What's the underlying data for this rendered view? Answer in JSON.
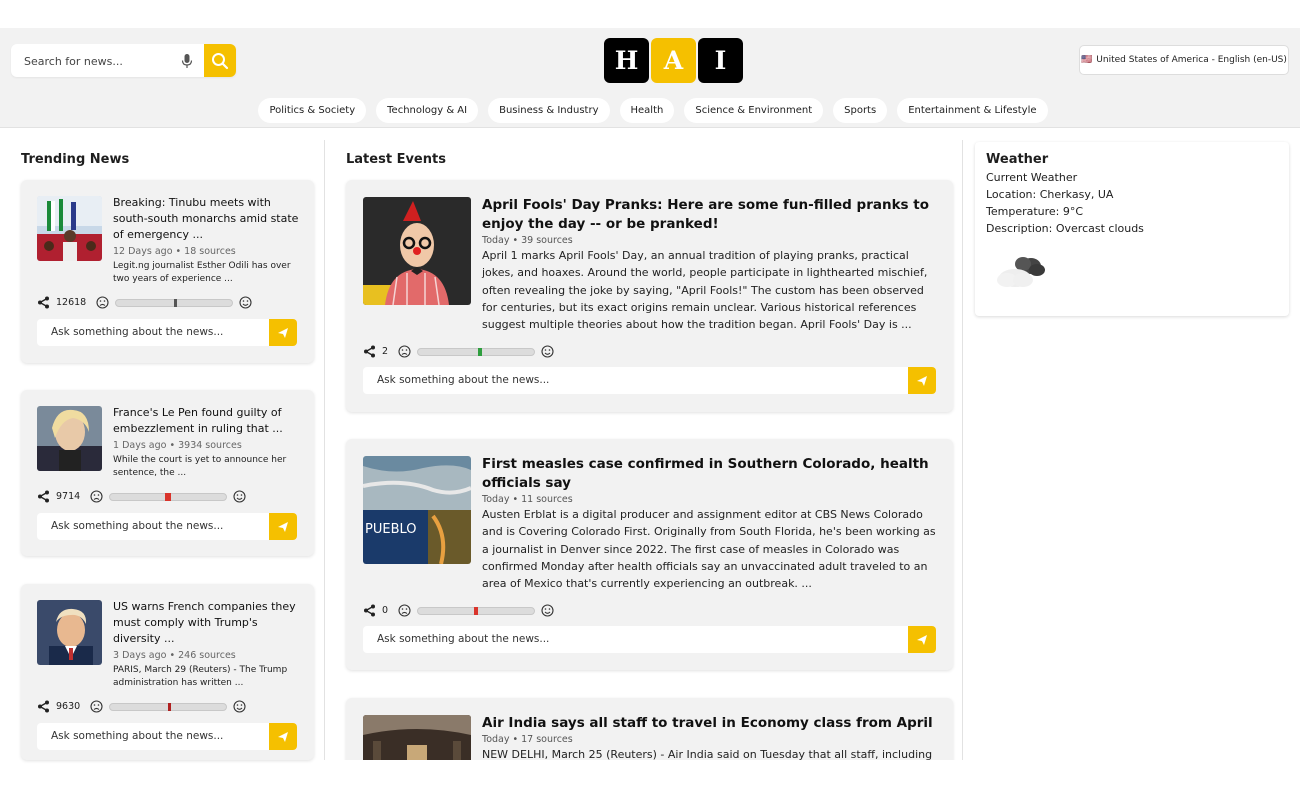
{
  "header": {
    "search_placeholder": "Search for news...",
    "logo_letters": [
      "H",
      "A",
      "I"
    ],
    "language_flag": "🇺🇸",
    "language_label": "United States of America - English (en-US)"
  },
  "categories": [
    "Politics & Society",
    "Technology & AI",
    "Business & Industry",
    "Health",
    "Science & Environment",
    "Sports",
    "Entertainment & Lifestyle"
  ],
  "trending": {
    "heading": "Trending News",
    "ask_placeholder": "Ask something about the news...",
    "items": [
      {
        "title": "Breaking: Tinubu meets with south-south monarchs amid state of emergency ...",
        "meta": "12 Days ago • 18 sources",
        "snippet": "Legit.ng journalist Esther Odili has over two years of experience ...",
        "shares": "12618",
        "sentiment": 0.5,
        "sentiment_color": "#555555"
      },
      {
        "title": "France's Le Pen found guilty of embezzlement in ruling that ...",
        "meta": "1 Days ago • 3934 sources",
        "snippet": "While the court is yet to announce her sentence, the ...",
        "shares": "9714",
        "sentiment": 0.47,
        "sentiment_color": "#d9342b"
      },
      {
        "title": "US warns French companies they must comply with Trump's diversity ...",
        "meta": "3 Days ago • 246 sources",
        "snippet": "PARIS, March 29 (Reuters) - The Trump administration has written ...",
        "shares": "9630",
        "sentiment": 0.5,
        "sentiment_color": "#b02020"
      }
    ]
  },
  "events": {
    "heading": "Latest Events",
    "ask_placeholder": "Ask something about the news...",
    "items": [
      {
        "title": "April Fools' Day Pranks: Here are some fun-filled pranks to enjoy the day -- or be pranked!",
        "meta": "Today • 39 sources",
        "body": "April 1 marks April Fools' Day, an annual tradition of playing pranks, practical jokes, and hoaxes. Around the world, people participate in lighthearted mischief, often revealing the joke by saying, \"April Fools!\" The custom has been observed for centuries, but its exact origins remain unclear. Various historical references suggest multiple theories about how the tradition began. April Fools' Day is ...",
        "shares": "2",
        "sentiment": 0.52,
        "sentiment_color": "#2e9e3e"
      },
      {
        "title": "First measles case confirmed in Southern Colorado, health officials say",
        "meta": "Today • 11 sources",
        "body": "Austen Erblat is a digital producer and assignment editor at CBS News Colorado and is Covering Colorado First. Originally from South Florida, he's been working as a journalist in Denver since 2022. The first case of measles in Colorado was confirmed Monday after health officials say an unvaccinated adult traveled to an area of Mexico that's currently experiencing an outbreak. ...",
        "shares": "0",
        "sentiment": 0.48,
        "sentiment_color": "#d9342b",
        "image_caption": "PUEBLO"
      },
      {
        "title": "Air India says all staff to travel in Economy class from April",
        "meta": "Today • 17 sources",
        "body": "NEW DELHI, March 25 (Reuters) - Air India said on Tuesday that all staff, including"
      }
    ]
  },
  "weather": {
    "heading": "Weather",
    "subtitle": "Current Weather",
    "location": "Location: Cherkasy, UA",
    "temperature": "Temperature: 9°C",
    "description": "Description: Overcast clouds"
  },
  "colors": {
    "accent": "#f5c000",
    "card_bg": "#f2f2f2"
  }
}
